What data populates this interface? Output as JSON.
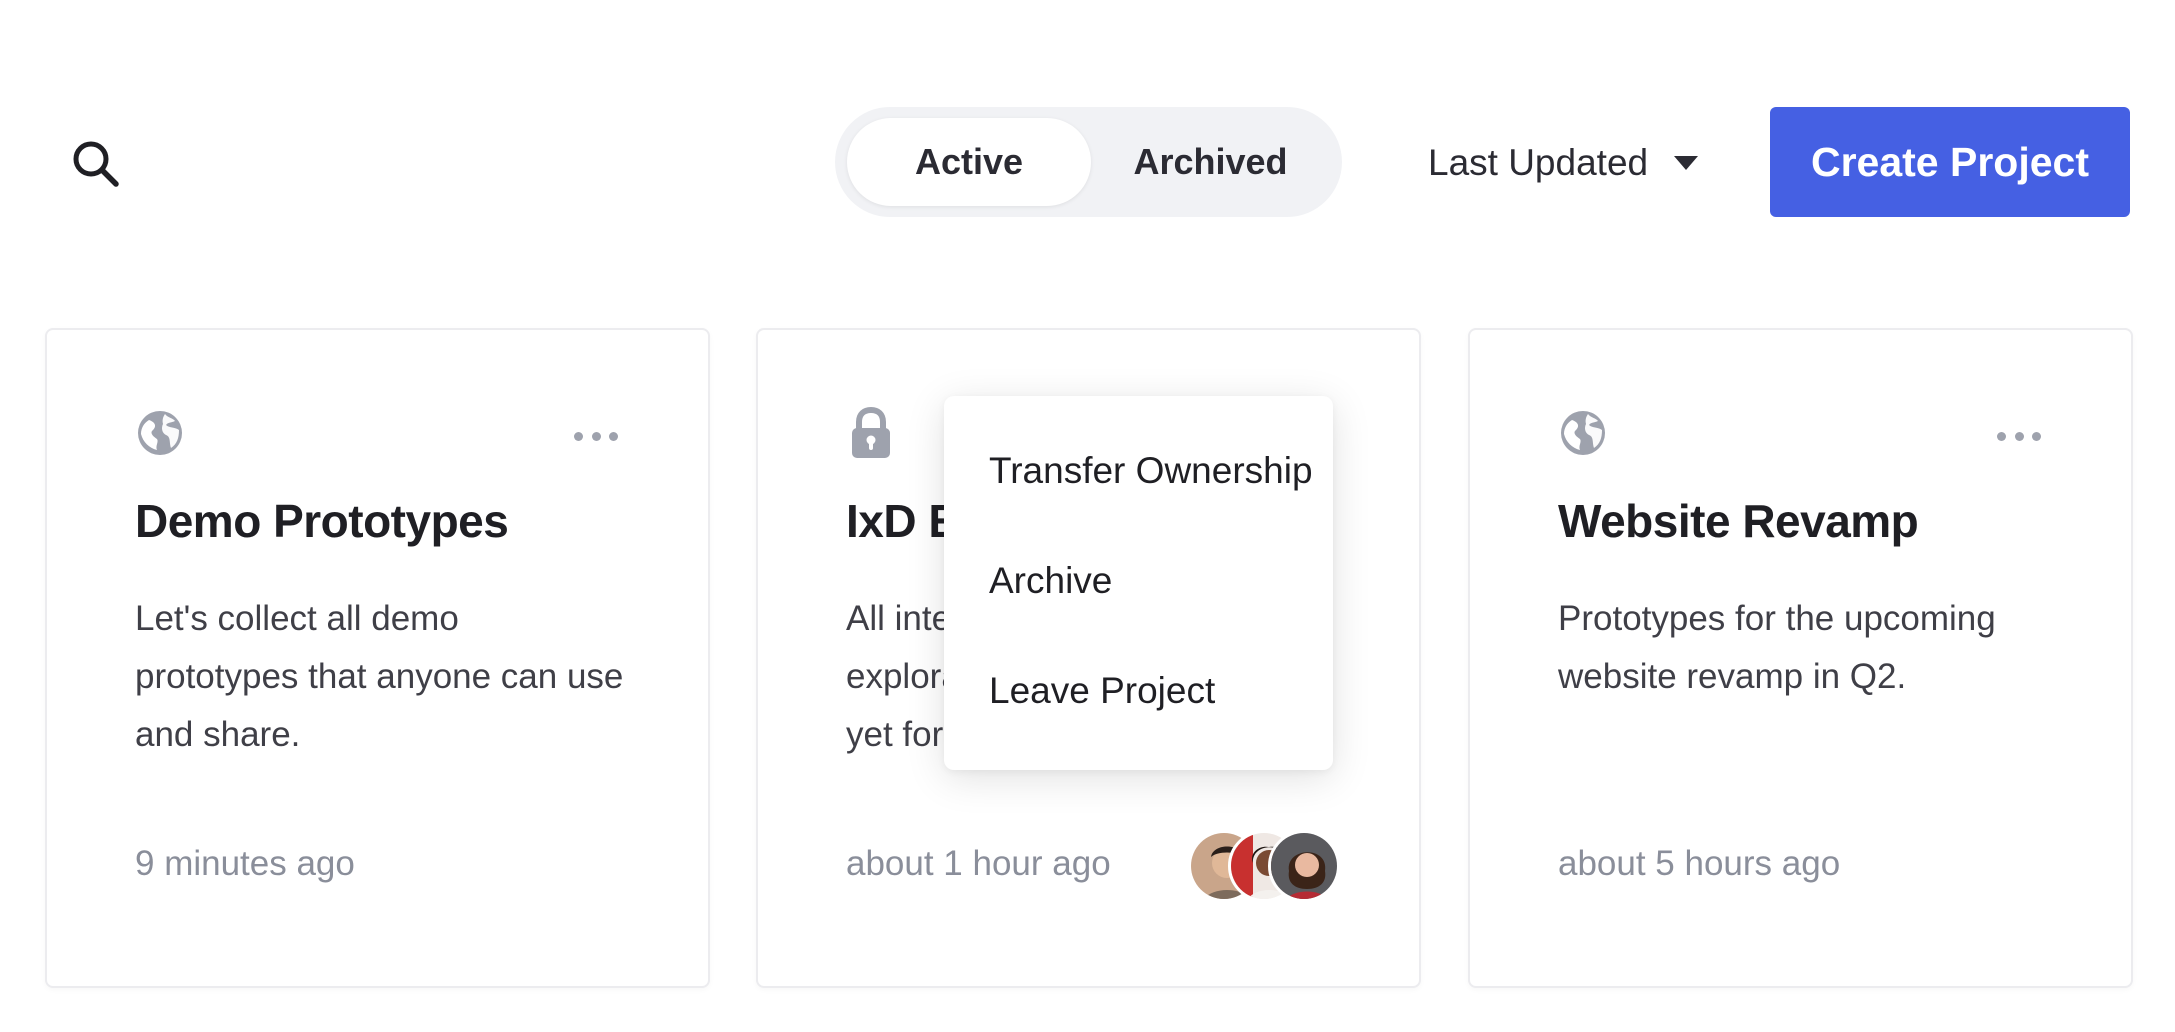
{
  "toolbar": {
    "search_icon": "search-icon",
    "filter_tabs": [
      {
        "label": "Active",
        "selected": true
      },
      {
        "label": "Archived",
        "selected": false
      }
    ],
    "sort": {
      "label": "Last Updated",
      "icon": "caret-down-icon"
    },
    "create_label": "Create Project"
  },
  "colors": {
    "accent": "#4560e3",
    "icon_gray": "#9ea2ad",
    "muted_text": "#8a8e9a"
  },
  "projects": [
    {
      "visibility_icon": "globe-icon",
      "title": "Demo Prototypes",
      "description": "Let's collect all demo prototypes that anyone can use and share.",
      "updated": "9 minutes ago",
      "members": []
    },
    {
      "visibility_icon": "lock-icon",
      "title": "IxD E",
      "description": "All inte explora yet for",
      "updated": "about 1 hour ago",
      "members": [
        "avatar-1",
        "avatar-2",
        "avatar-3"
      ]
    },
    {
      "visibility_icon": "globe-icon",
      "title": "Website Revamp",
      "description": "Prototypes for the upcoming website revamp in Q2.",
      "updated": "about 5 hours ago",
      "members": []
    }
  ],
  "context_menu": {
    "items": [
      "Transfer Ownership",
      "Archive",
      "Leave Project"
    ]
  }
}
